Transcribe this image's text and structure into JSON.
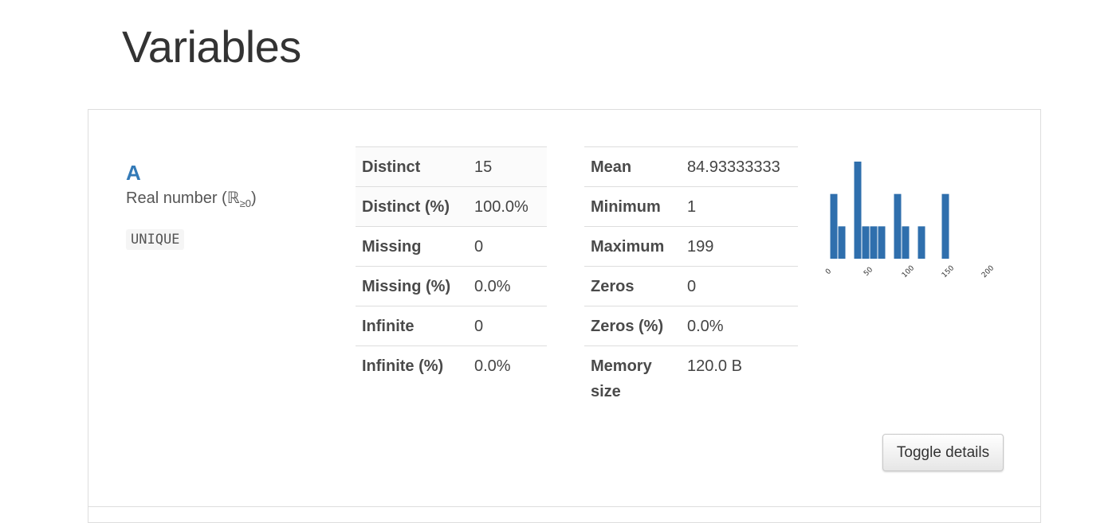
{
  "page": {
    "title": "Variables"
  },
  "variable": {
    "name": "A",
    "type": "Real number (ℝ",
    "type_sub": "≥0",
    "type_end": ")",
    "badge": "UNIQUE"
  },
  "stats_left": [
    {
      "label": "Distinct",
      "value": "15"
    },
    {
      "label": "Distinct (%)",
      "value": "100.0%"
    },
    {
      "label": "Missing",
      "value": "0"
    },
    {
      "label": "Missing (%)",
      "value": "0.0%"
    },
    {
      "label": "Infinite",
      "value": "0"
    },
    {
      "label": "Infinite (%)",
      "value": "0.0%"
    }
  ],
  "stats_right": [
    {
      "label": "Mean",
      "value": "84.93333333"
    },
    {
      "label": "Minimum",
      "value": "1"
    },
    {
      "label": "Maximum",
      "value": "199"
    },
    {
      "label": "Zeros",
      "value": "0"
    },
    {
      "label": "Zeros (%)",
      "value": "0.0%"
    },
    {
      "label": "Memory size",
      "value": "120.0 B"
    }
  ],
  "colors": {
    "accent": "#337ab7",
    "bar": "#2f6fad"
  },
  "chart_data": {
    "type": "bar",
    "x_tick_labels": [
      "0",
      "50",
      "100",
      "150",
      "200"
    ],
    "xlim": [
      0,
      200
    ],
    "bins": [
      {
        "start": 0,
        "end": 10,
        "count": 2
      },
      {
        "start": 10,
        "end": 20,
        "count": 1
      },
      {
        "start": 20,
        "end": 30,
        "count": 0
      },
      {
        "start": 30,
        "end": 40,
        "count": 3
      },
      {
        "start": 40,
        "end": 50,
        "count": 1
      },
      {
        "start": 50,
        "end": 60,
        "count": 1
      },
      {
        "start": 60,
        "end": 70,
        "count": 1
      },
      {
        "start": 70,
        "end": 80,
        "count": 0
      },
      {
        "start": 80,
        "end": 90,
        "count": 2
      },
      {
        "start": 90,
        "end": 100,
        "count": 1
      },
      {
        "start": 100,
        "end": 110,
        "count": 0
      },
      {
        "start": 110,
        "end": 120,
        "count": 1
      },
      {
        "start": 120,
        "end": 130,
        "count": 0
      },
      {
        "start": 130,
        "end": 140,
        "count": 0
      },
      {
        "start": 140,
        "end": 150,
        "count": 2
      }
    ],
    "ylim": [
      0,
      3
    ],
    "grid": false
  },
  "actions": {
    "toggle_label": "Toggle details"
  }
}
